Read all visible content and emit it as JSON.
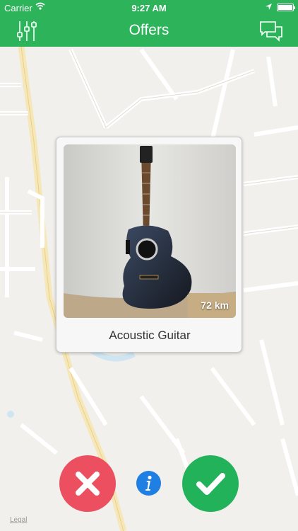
{
  "status_bar": {
    "carrier": "Carrier",
    "time": "9:27 AM"
  },
  "nav": {
    "title": "Offers",
    "left_icon": "filter-sliders-icon",
    "right_icon": "chat-bubbles-icon"
  },
  "map": {
    "legal": "Legal"
  },
  "offer": {
    "title": "Acoustic Guitar",
    "distance": "72 km"
  },
  "actions": {
    "reject_icon": "close-icon",
    "info_icon": "info-icon",
    "accept_icon": "checkmark-icon"
  },
  "colors": {
    "brand_green": "#2db35a",
    "reject_red": "#ec4f60",
    "accept_green": "#22b25a",
    "info_blue": "#1f7fe2"
  }
}
